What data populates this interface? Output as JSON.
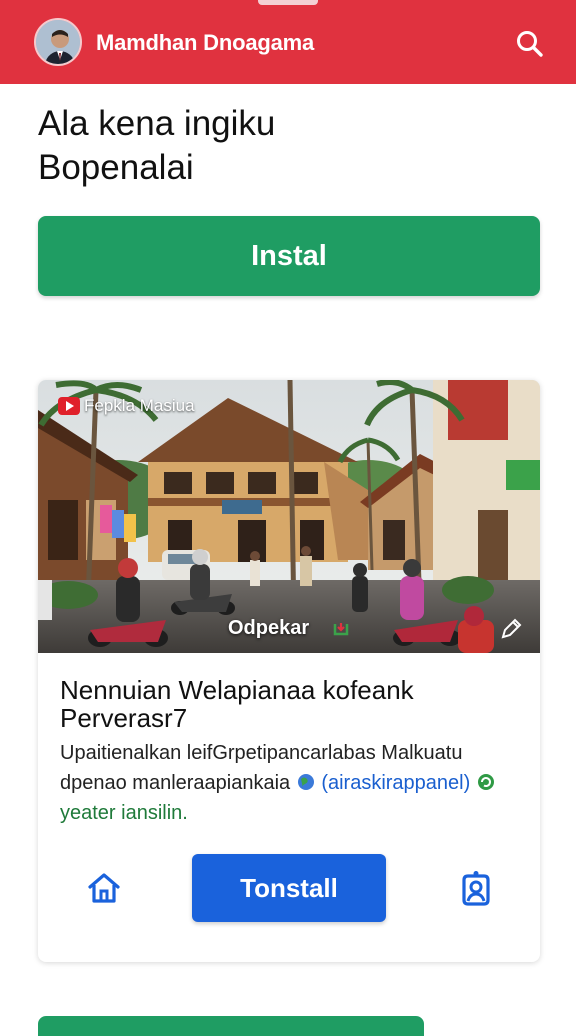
{
  "header": {
    "username": "Mamdhan Dnoagama",
    "avatar_icon": "user-avatar",
    "search_icon": "search-icon",
    "color": "#e0323f"
  },
  "hero": {
    "headline_line1": "Ala kena ingiku",
    "headline_line2": "Bopenalai",
    "install_label": "Instal",
    "install_color": "#1f9d63"
  },
  "card": {
    "channel_label": "Fepkla Masiua",
    "overlay_caption": "Odpekar",
    "title_line1": "Nennuian Welapianaa kofeank",
    "title_line2": "Perverasr7",
    "desc_line1": "Upaitienalkan leifGrpetipancarlabas Malkuatu",
    "desc_line2_text": "dpenao manleraapiankaia",
    "desc_link": "(airaskirappanel)",
    "desc_line3": "yeater iansilin.",
    "install_label": "Tonstall",
    "install_color": "#1a62dc"
  },
  "icons": {
    "home": "home-icon",
    "profile": "profile-icon",
    "edit": "edit-icon",
    "play": "play-icon"
  }
}
